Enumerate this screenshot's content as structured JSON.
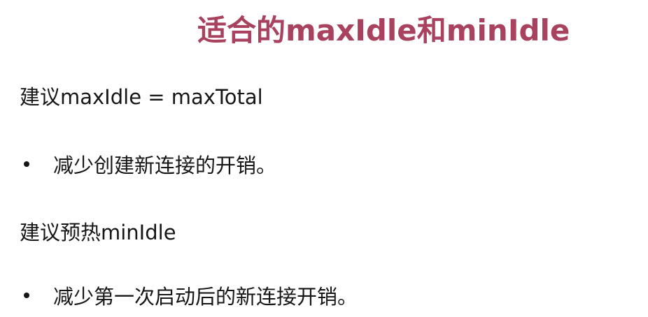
{
  "slide": {
    "title": "适合的maxIdle和minIdle",
    "lines": [
      "建议maxIdle = maxTotal",
      "减少创建新连接的开销。",
      "建议预热minIdle",
      "减少第一次启动后的新连接开销。"
    ],
    "colors": {
      "title": "#a8425f",
      "text": "#161616",
      "background": "#ffffff"
    }
  }
}
